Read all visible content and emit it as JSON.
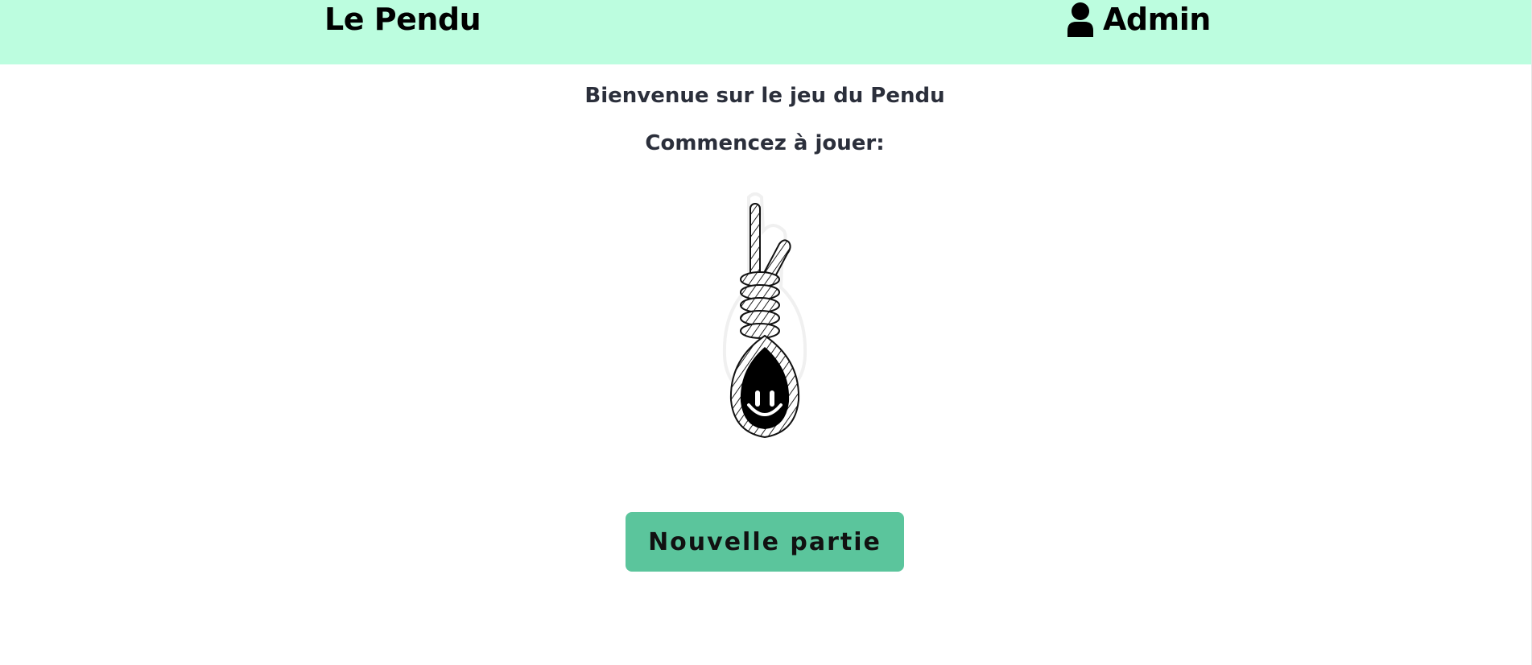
{
  "navbar": {
    "brand": "Le Pendu",
    "user_label": "Admin",
    "user_icon": "user-icon",
    "background": "#bcfddf"
  },
  "main": {
    "welcome": "Bienvenue sur le jeu du Pendu",
    "start_prompt": "Commencez à jouer:",
    "illustration": "noose-smiley-icon",
    "new_game_label": "Nouvelle partie",
    "button_color": "#5bc59c"
  }
}
